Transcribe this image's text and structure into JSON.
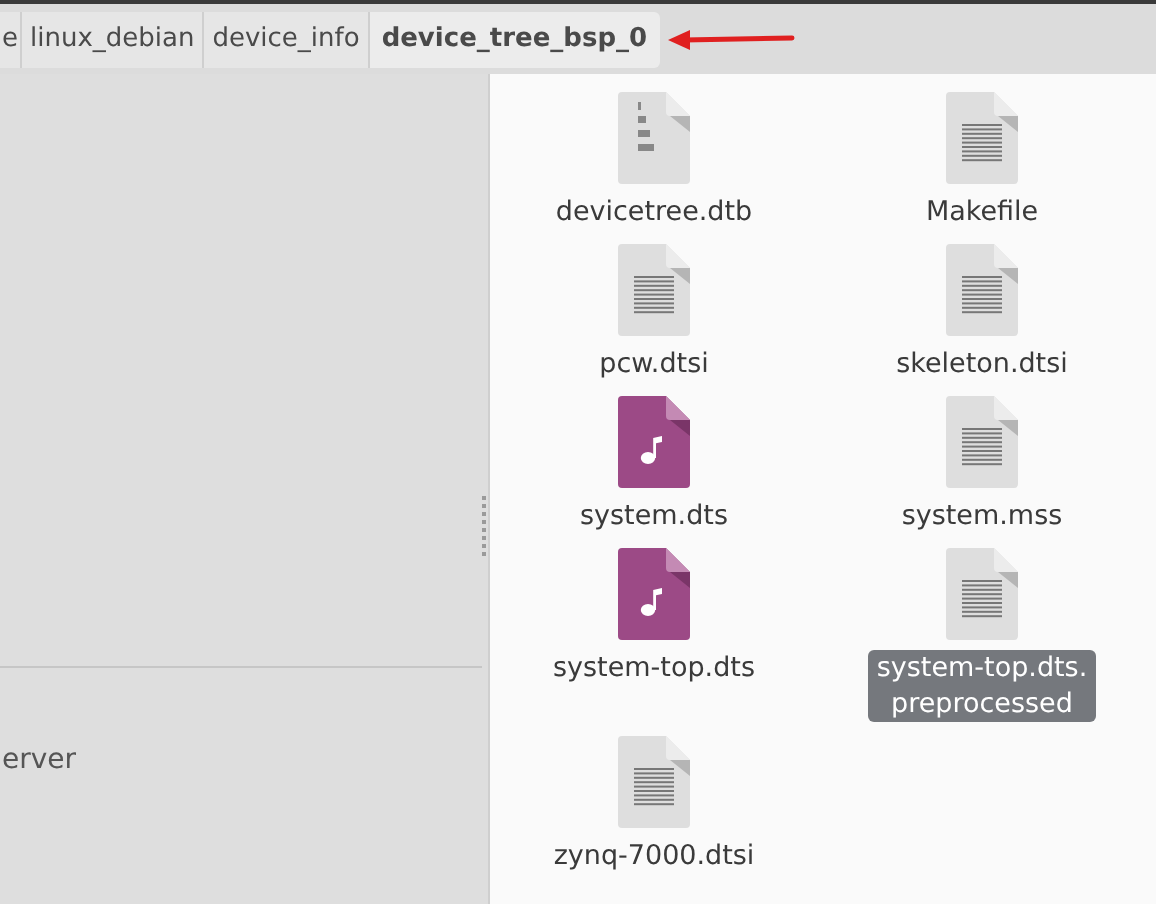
{
  "breadcrumbs": [
    {
      "label": "e",
      "selected": false
    },
    {
      "label": "linux_debian",
      "selected": false
    },
    {
      "label": "device_info",
      "selected": false
    },
    {
      "label": "device_tree_bsp_0",
      "selected": true
    }
  ],
  "sidebar": {
    "items": [
      {
        "label": "erver"
      }
    ]
  },
  "files": [
    {
      "name": "devicetree.dtb",
      "kind": "binary",
      "selected": false
    },
    {
      "name": "Makefile",
      "kind": "text",
      "selected": false
    },
    {
      "name": "pcw.dtsi",
      "kind": "text",
      "selected": false
    },
    {
      "name": "skeleton.dtsi",
      "kind": "text",
      "selected": false
    },
    {
      "name": "system.dts",
      "kind": "audio",
      "selected": false
    },
    {
      "name": "system.mss",
      "kind": "text",
      "selected": false
    },
    {
      "name": "system-top.dts",
      "kind": "audio",
      "selected": false
    },
    {
      "name": "system-top.dts.\npreprocessed",
      "kind": "text",
      "selected": true
    },
    {
      "name": "zynq-7000.dtsi",
      "kind": "text",
      "selected": false
    }
  ]
}
